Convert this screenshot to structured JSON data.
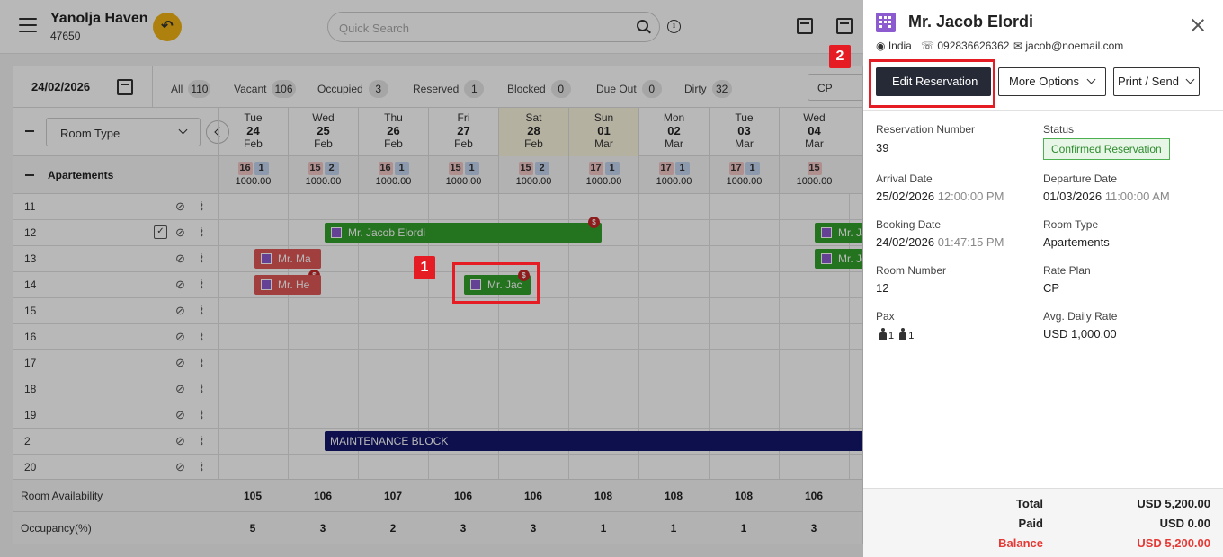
{
  "header": {
    "hotel_name": "Yanolja Haven",
    "hotel_code": "47650",
    "search_placeholder": "Quick Search"
  },
  "filter_bar": {
    "date": "24/02/2026",
    "filters": [
      {
        "label": "All",
        "count": "110"
      },
      {
        "label": "Vacant",
        "count": "106"
      },
      {
        "label": "Occupied",
        "count": "3"
      },
      {
        "label": "Reserved",
        "count": "1"
      },
      {
        "label": "Blocked",
        "count": "0"
      },
      {
        "label": "Due Out",
        "count": "0"
      },
      {
        "label": "Dirty",
        "count": "32"
      }
    ],
    "rate_plan": "CP"
  },
  "grid": {
    "room_type_select": "Room Type",
    "group_label": "Apartements",
    "days": [
      {
        "dow": "Tue",
        "day": "24",
        "mon": "Feb",
        "red": "16",
        "blue": "1",
        "rate": "1000.00",
        "weekend": false
      },
      {
        "dow": "Wed",
        "day": "25",
        "mon": "Feb",
        "red": "15",
        "blue": "2",
        "rate": "1000.00",
        "weekend": false
      },
      {
        "dow": "Thu",
        "day": "26",
        "mon": "Feb",
        "red": "16",
        "blue": "1",
        "rate": "1000.00",
        "weekend": false
      },
      {
        "dow": "Fri",
        "day": "27",
        "mon": "Feb",
        "red": "15",
        "blue": "1",
        "rate": "1000.00",
        "weekend": false
      },
      {
        "dow": "Sat",
        "day": "28",
        "mon": "Feb",
        "red": "15",
        "blue": "2",
        "rate": "1000.00",
        "weekend": true
      },
      {
        "dow": "Sun",
        "day": "01",
        "mon": "Mar",
        "red": "17",
        "blue": "1",
        "rate": "1000.00",
        "weekend": true
      },
      {
        "dow": "Mon",
        "day": "02",
        "mon": "Mar",
        "red": "17",
        "blue": "1",
        "rate": "1000.00",
        "weekend": false
      },
      {
        "dow": "Tue",
        "day": "03",
        "mon": "Mar",
        "red": "17",
        "blue": "1",
        "rate": "1000.00",
        "weekend": false
      },
      {
        "dow": "Wed",
        "day": "04",
        "mon": "Mar",
        "red": "15",
        "blue": "",
        "rate": "1000.00",
        "weekend": false
      }
    ],
    "rooms": [
      "11",
      "12",
      "13",
      "14",
      "15",
      "16",
      "17",
      "18",
      "19",
      "2",
      "20"
    ],
    "bookings": {
      "room12_main": "Mr. Jacob Elordi",
      "room12_right": "Mr. Ja",
      "room13_right": "Mr. Jo",
      "room13_left": "Mr. Ma",
      "room14_left": "Mr. He",
      "room14_selected": "Mr. Jac",
      "maintenance": "MAINTENANCE BLOCK"
    },
    "availability_label": "Room Availability",
    "availability": [
      "105",
      "106",
      "107",
      "106",
      "106",
      "108",
      "108",
      "108",
      "106"
    ],
    "occupancy_label": "Occupancy(%)",
    "occupancy": [
      "5",
      "3",
      "2",
      "3",
      "3",
      "1",
      "1",
      "1",
      "3"
    ]
  },
  "callouts": {
    "one": "1",
    "two": "2"
  },
  "panel": {
    "guest_name": "Mr. Jacob Elordi",
    "country": "India",
    "phone": "092836626362",
    "email": "jacob@noemail.com",
    "buttons": {
      "edit": "Edit Reservation",
      "more": "More Options",
      "print": "Print / Send"
    },
    "fields": {
      "reservation_number_label": "Reservation Number",
      "reservation_number": "39",
      "status_label": "Status",
      "status": "Confirmed Reservation",
      "arrival_label": "Arrival Date",
      "arrival_date": "25/02/2026",
      "arrival_time": "12:00:00 PM",
      "departure_label": "Departure Date",
      "departure_date": "01/03/2026",
      "departure_time": "11:00:00 AM",
      "booking_label": "Booking Date",
      "booking_date": "24/02/2026",
      "booking_time": "01:47:15 PM",
      "room_type_label": "Room Type",
      "room_type": "Apartements",
      "room_number_label": "Room Number",
      "room_number": "12",
      "rate_plan_label": "Rate Plan",
      "rate_plan": "CP",
      "pax_label": "Pax",
      "pax_adults": "1",
      "pax_children": "1",
      "adr_label": "Avg. Daily Rate",
      "adr": "USD 1,000.00"
    },
    "totals": {
      "total_label": "Total",
      "total": "USD 5,200.00",
      "paid_label": "Paid",
      "paid": "USD 0.00",
      "balance_label": "Balance",
      "balance": "USD 5,200.00"
    }
  }
}
